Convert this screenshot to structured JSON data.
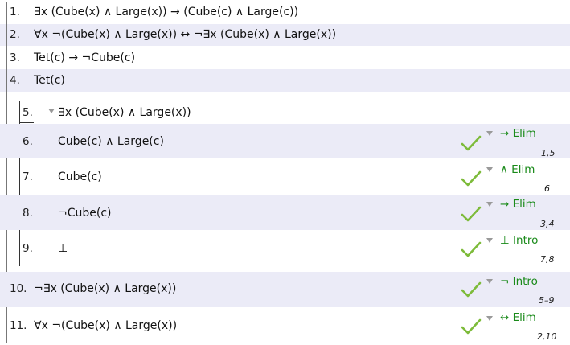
{
  "premises": [
    {
      "num": "1.",
      "formula": "∃x (Cube(x) ∧ Large(x)) → (Cube(c) ∧ Large(c))"
    },
    {
      "num": "2.",
      "formula": "∀x ¬(Cube(x) ∧ Large(x)) ↔ ¬∃x (Cube(x) ∧ Large(x))"
    },
    {
      "num": "3.",
      "formula": "Tet(c) → ¬Cube(c)"
    },
    {
      "num": "4.",
      "formula": "Tet(c)"
    }
  ],
  "subproof": {
    "assumption": {
      "num": "5.",
      "formula": "∃x (Cube(x) ∧ Large(x))"
    },
    "steps": [
      {
        "num": "6.",
        "formula": "Cube(c) ∧ Large(c)",
        "rule": "→ Elim",
        "support": "1,5"
      },
      {
        "num": "7.",
        "formula": "Cube(c)",
        "rule": "∧ Elim",
        "support": "6"
      },
      {
        "num": "8.",
        "formula": "¬Cube(c)",
        "rule": "→ Elim",
        "support": "3,4"
      },
      {
        "num": "9.",
        "formula": "⊥",
        "rule": "⊥ Intro",
        "support": "7,8"
      }
    ]
  },
  "conclusions": [
    {
      "num": "10.",
      "formula": "¬∃x (Cube(x) ∧ Large(x))",
      "rule": "¬ Intro",
      "support": "5–9"
    },
    {
      "num": "11.",
      "formula": "∀x ¬(Cube(x) ∧ Large(x))",
      "rule": "↔ Elim",
      "support": "2,10"
    }
  ],
  "colors": {
    "rule": "#1a8a1a",
    "check": "#7dbb3a",
    "alt_row": "#ebebf7"
  }
}
